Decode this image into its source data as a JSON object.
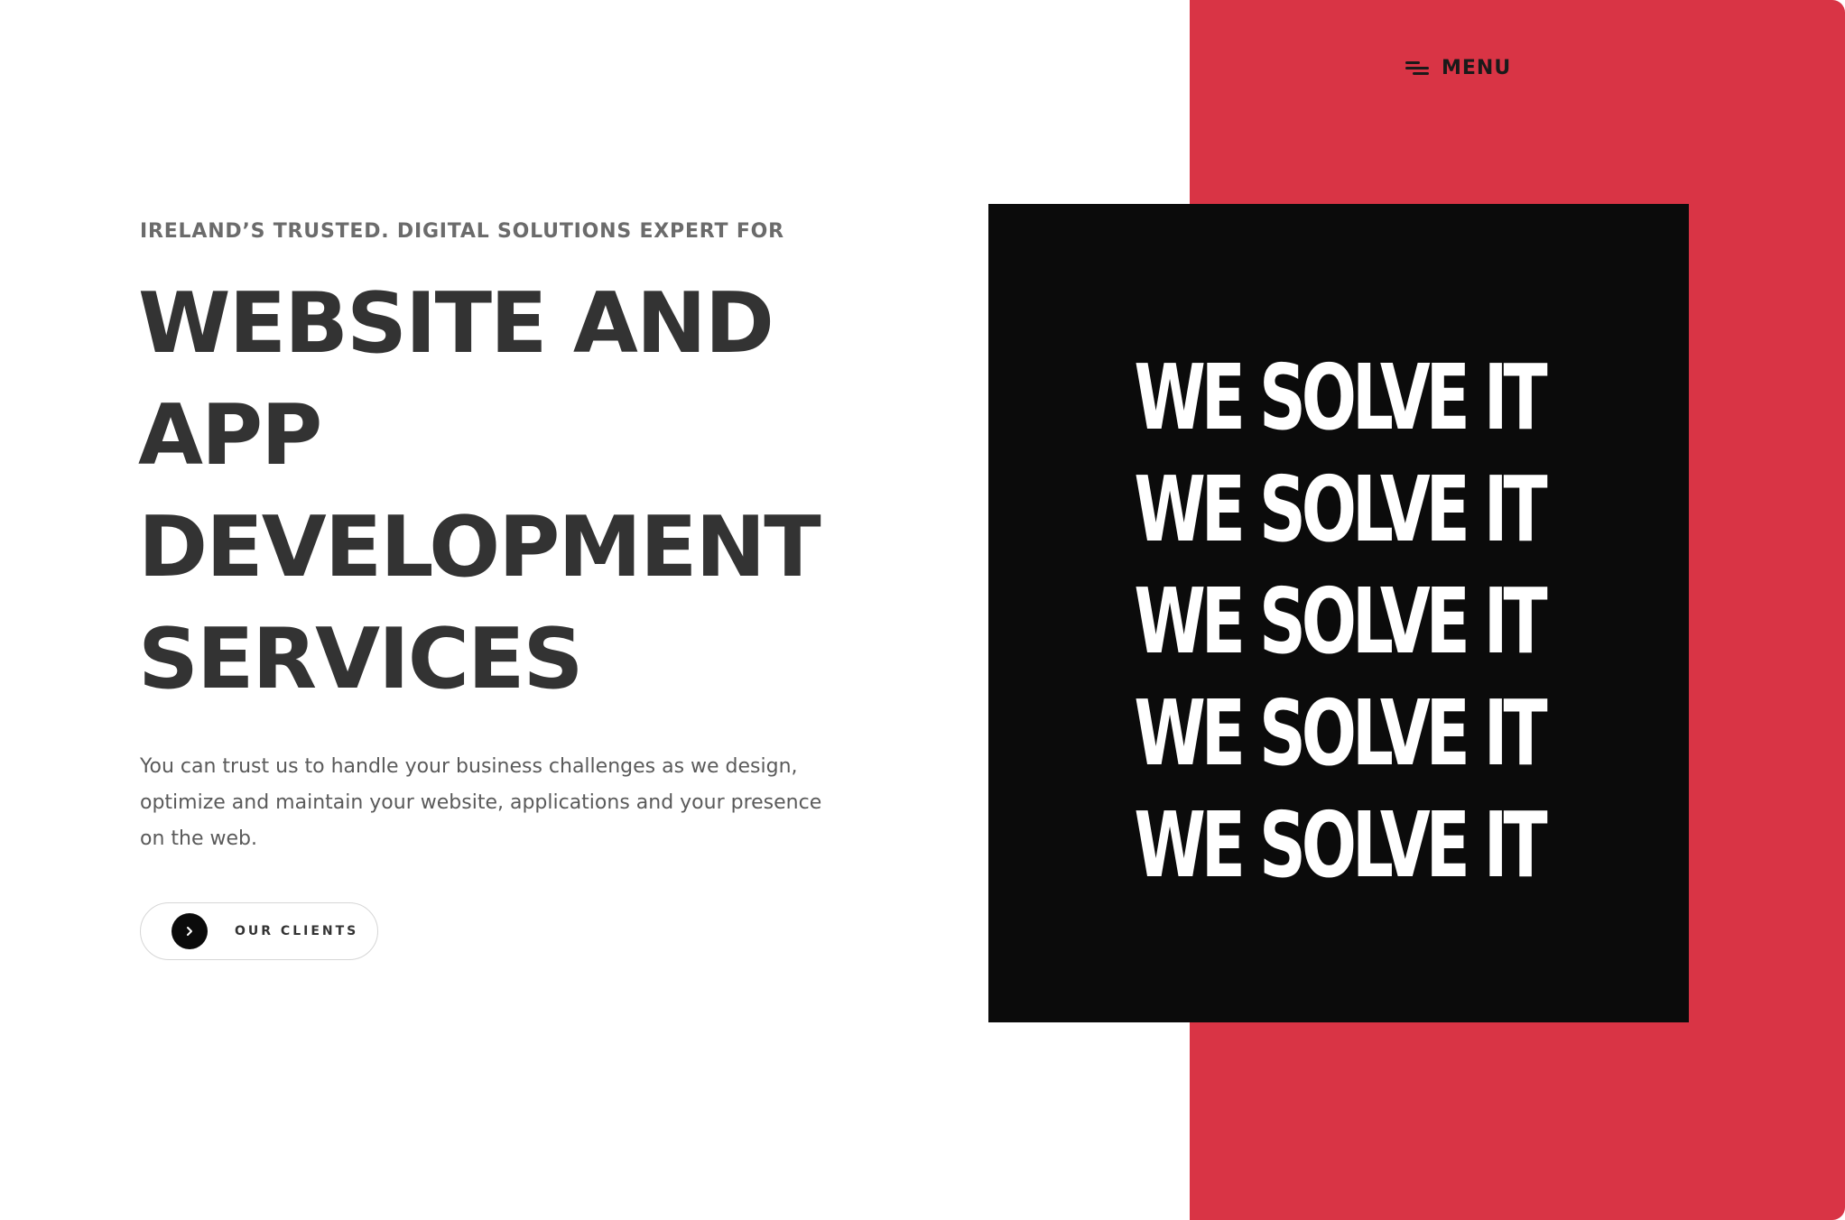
{
  "colors": {
    "accent_red": "#d93445",
    "card_black": "#0b0b0b",
    "heading_text": "#333333",
    "body_text": "#5a5a5a",
    "background": "#ffffff"
  },
  "nav": {
    "menu_icon": "hamburger-menu-icon",
    "menu_label": "MENU"
  },
  "hero": {
    "eyebrow": "IRELAND’S TRUSTED. DIGITAL SOLUTIONS EXPERT FOR",
    "headline_lines": [
      "WEBSITE AND",
      "APP",
      "DEVELOPMENT",
      "SERVICES"
    ],
    "description": "You can trust us to handle your business challenges as we design, optimize and maintain your website, applications and your presence on the web.",
    "cta": {
      "icon": "chevron-right-icon",
      "label": "OUR CLIENTS"
    }
  },
  "feature_card": {
    "lines": [
      "WE SOLVE IT",
      "WE SOLVE IT",
      "WE SOLVE IT",
      "WE SOLVE IT",
      "WE SOLVE IT"
    ]
  }
}
